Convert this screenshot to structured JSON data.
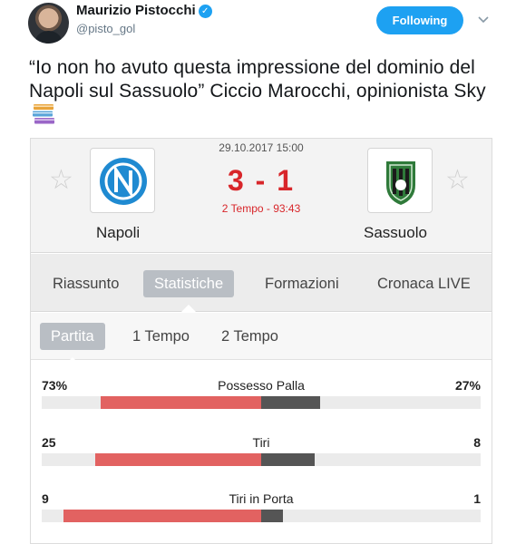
{
  "tweet": {
    "author_name": "Maurizio Pistocchi",
    "author_handle": "@pisto_gol",
    "follow_label": "Following",
    "text": "“Io non ho avuto questa impressione del dominio del Napoli sul Sassuolo” Ciccio Marocchi, opinionista Sky",
    "verified_icon": "verified-badge-icon",
    "emoji_icon": "books-icon",
    "accent_color": "#1da1f2"
  },
  "match": {
    "date": "29.10.2017 15:00",
    "score": "3 - 1",
    "period": "2 Tempo - 93:43",
    "home_team": "Napoli",
    "away_team": "Sassuolo",
    "score_color": "#d8262a"
  },
  "tabs": [
    "Riassunto",
    "Statistiche",
    "Formazioni",
    "Cronaca LIVE"
  ],
  "active_tab": "Statistiche",
  "subtabs": [
    "Partita",
    "1 Tempo",
    "2 Tempo"
  ],
  "active_subtab": "Partita",
  "stats": [
    {
      "label": "Possesso Palla",
      "home": "73%",
      "away": "27%",
      "home_value": 73,
      "away_value": 27
    },
    {
      "label": "Tiri",
      "home": "25",
      "away": "8",
      "home_value": 25,
      "away_value": 8
    },
    {
      "label": "Tiri in Porta",
      "home": "9",
      "away": "1",
      "home_value": 9,
      "away_value": 1
    }
  ],
  "stat_colors": {
    "home": "#e26261",
    "away": "#555555"
  }
}
